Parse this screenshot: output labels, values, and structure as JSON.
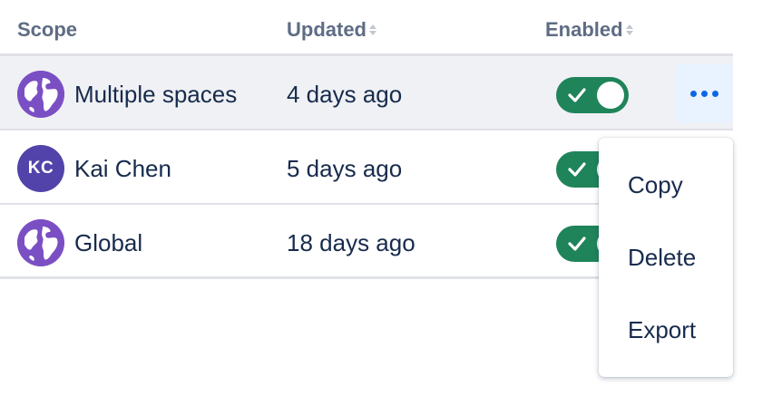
{
  "table": {
    "columns": [
      {
        "label": "Scope",
        "sortable": false
      },
      {
        "label": "Updated",
        "sortable": true
      },
      {
        "label": "Enabled",
        "sortable": true
      }
    ],
    "rows": [
      {
        "scope": "Multiple spaces",
        "avatar": "globe-icon",
        "updated": "4 days ago",
        "enabled": true
      },
      {
        "scope": "Kai Chen",
        "avatar_initials": "KC",
        "updated": "5 days ago",
        "enabled": true
      },
      {
        "scope": "Global",
        "avatar": "globe-icon",
        "updated": "18 days ago",
        "enabled": true
      }
    ]
  },
  "menu": {
    "items": [
      {
        "label": "Copy"
      },
      {
        "label": "Delete"
      },
      {
        "label": "Export"
      }
    ]
  },
  "colors": {
    "toggle_on": "#1f845a",
    "avatar_globe": "#7b4fc4",
    "avatar_initials": "#5243aa",
    "more_button_bg": "#e9f2ff",
    "more_dots": "#0c66e4"
  }
}
